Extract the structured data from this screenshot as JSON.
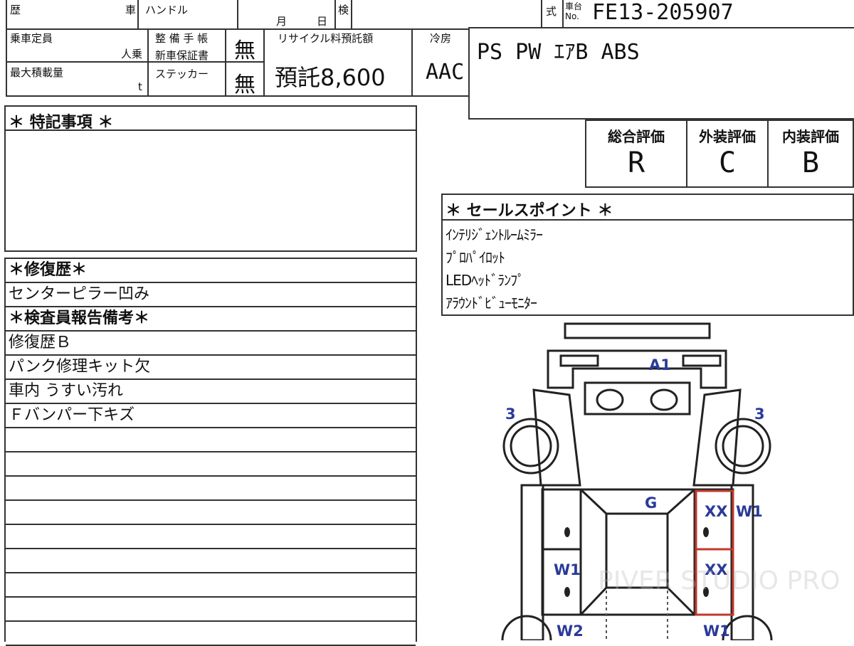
{
  "header": {
    "reki": "歴",
    "sha": "車",
    "handle_label": "ハンドル",
    "month_label": "月",
    "day_label": "日",
    "ken": "検",
    "shiki": "式",
    "chassis_label_1": "車台",
    "chassis_label_2": "No.",
    "chassis_no": "FE13-205907"
  },
  "specs": {
    "capacity_label": "乗車定員",
    "capacity_unit": "人乗",
    "max_load_label": "最大積載量",
    "max_load_unit": "t",
    "maintenance_label_1": "整 備 手 帳",
    "maintenance_label_2": "新車保証書",
    "maintenance_value": "無",
    "sticker_label": "ステッカー",
    "sticker_value": "無",
    "recycle_label": "リサイクル料預託額",
    "recycle_value": "預託8,600",
    "ac_label": "冷房",
    "ac_value": "AAC",
    "equipment": "PS PW ｴｱB ABS"
  },
  "ratings": {
    "overall_label": "総合評価",
    "overall": "R",
    "exterior_label": "外装評価",
    "exterior": "C",
    "interior_label": "内装評価",
    "interior": "B"
  },
  "special_notes": {
    "title": "＊ 特記事項 ＊"
  },
  "sales_points": {
    "title": "＊ セールスポイント ＊",
    "items": [
      "ｲﾝﾃﾘｼﾞｪﾝﾄﾙｰﾑﾐﾗｰ",
      "ﾌﾟﾛﾊﾟｲﾛｯﾄ",
      "LEDﾍｯﾄﾞﾗﾝﾌﾟ",
      "ｱﾗｳﾝﾄﾞﾋﾞｭｰﾓﾆﾀｰ"
    ]
  },
  "remarks": {
    "repair_title": "＊修復歴＊",
    "repair_item": "センターピラー凹み",
    "inspector_title": "＊検査員報告備考＊",
    "items": [
      "修復歴Ｂ",
      "パンク修理キット欠",
      "車内 うすい汚れ",
      "Ｆバンパー下キズ"
    ]
  },
  "diagram": {
    "labels": {
      "a1": "A1",
      "left_tire": "3",
      "right_tire": "3",
      "g": "G",
      "xx_top": "XX",
      "w1_right_top": "W1",
      "w1_left": "W1",
      "xx_mid": "XX",
      "w2": "W2",
      "w1_bottom": "W1"
    },
    "watermark": "PIVER STUDIO PRO"
  }
}
